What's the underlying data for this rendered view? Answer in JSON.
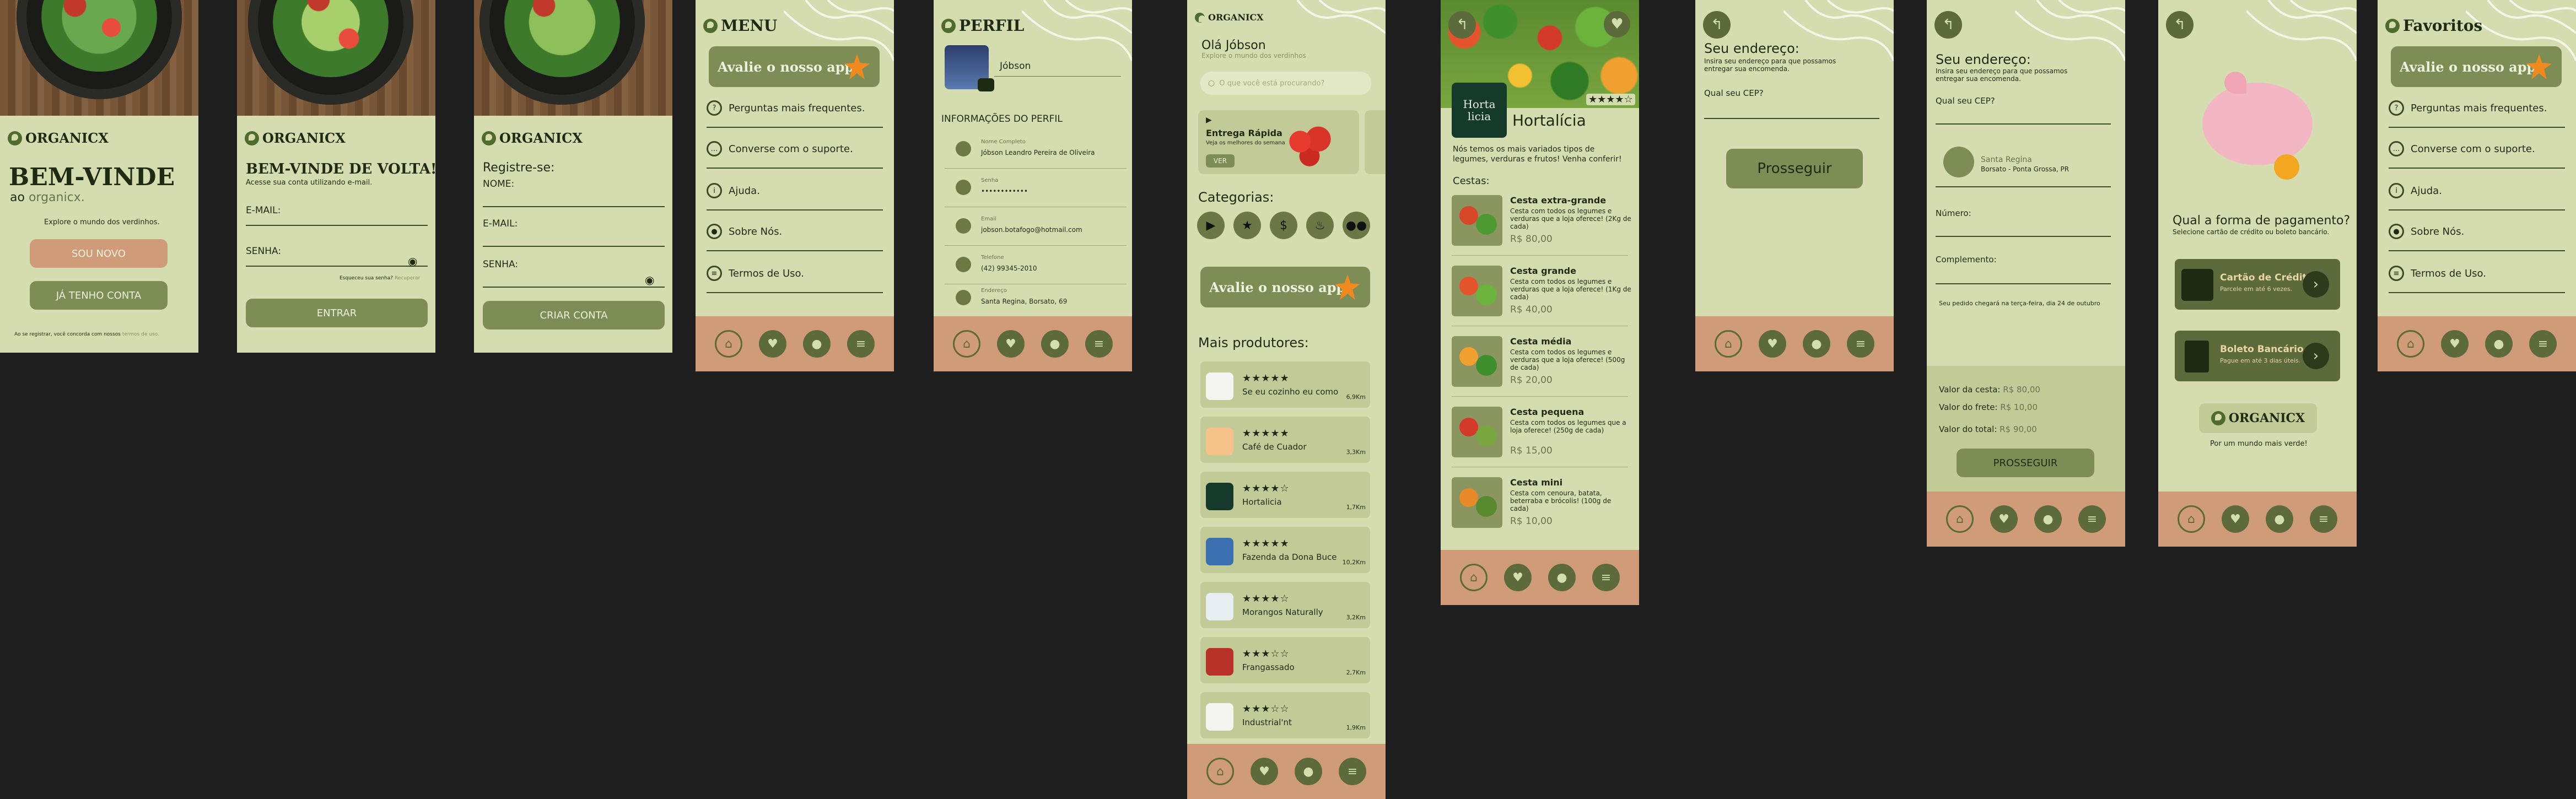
{
  "brand": "ORGANICX",
  "nav": {
    "icons": [
      "home-icon",
      "heart-icon",
      "user-icon",
      "menu-icon"
    ]
  },
  "welcome": {
    "heading": "BEM-VINDE",
    "subtitle_prefix": "ao",
    "subtitle_brand": "organicx.",
    "tagline": "Explore o mundo dos verdinhos.",
    "new_button": "SOU NOVO",
    "have_account_button": "JÁ TENHO CONTA",
    "terms_text": "Ao se registrar, você concorda com nossos",
    "terms_link": "termos de uso."
  },
  "login": {
    "heading": "BEM-VINDE DE VOLTA!",
    "subtitle": "Acesse sua conta utilizando e-mail.",
    "email_label": "E-MAIL:",
    "password_label": "SENHA:",
    "forgot_text": "Esqueceu sua senha?",
    "forgot_link": "Recuperar",
    "enter_button": "ENTRAR"
  },
  "register": {
    "heading": "Registre-se:",
    "name_label": "NOME:",
    "email_label": "E-MAIL:",
    "password_label": "SENHA:",
    "create_button": "CRIAR CONTA"
  },
  "menu": {
    "title": "MENU",
    "rate_banner": "Avalie o nosso app",
    "items": [
      {
        "label": "Perguntas mais frequentes.",
        "icon": "question-icon"
      },
      {
        "label": "Converse com o suporte.",
        "icon": "chat-icon"
      },
      {
        "label": "Ajuda.",
        "icon": "info-icon"
      },
      {
        "label": "Sobre Nós.",
        "icon": "team-icon"
      },
      {
        "label": "Termos de Uso.",
        "icon": "document-icon"
      }
    ]
  },
  "profile": {
    "title": "PERFIL",
    "name": "Jóbson",
    "section_title": "INFORMAÇÕES DO PERFIL",
    "fields": [
      {
        "label": "Nome Completo",
        "value": "Jóbson Leandro Pereira de Oliveira"
      },
      {
        "label": "Senha",
        "value": "••••••••••••"
      },
      {
        "label": "Email",
        "value": "jobson.botafogo@hotmail.com"
      },
      {
        "label": "Telefone",
        "value": "(42) 99345-2010"
      },
      {
        "label": "Endereço",
        "value": "Santa Regina, Borsato, 69"
      }
    ]
  },
  "home": {
    "brand": "ORGANICX",
    "greeting": "Olá Jóbson",
    "greeting_sub": "Explore o mundo dos verdinhos",
    "search_placeholder": "O que você está procurando?",
    "promo_title": "Entrega Rápida",
    "promo_sub": "Veja os melhores do semana",
    "promo_button": "VER",
    "categories_title": "Categorias:",
    "category_icons": [
      "truck-icon",
      "star-icon",
      "dollar-icon",
      "fire-icon",
      "group-icon"
    ],
    "rate_banner": "Avalie o nosso app",
    "producers_title": "Mais produtores:",
    "producers": [
      {
        "name": "Se eu cozinho eu como",
        "stars": "★★★★★",
        "distance": "6,9Km"
      },
      {
        "name": "Café de Cuador",
        "stars": "★★★★★",
        "distance": "3,3Km"
      },
      {
        "name": "Hortalicia",
        "stars": "★★★★☆",
        "distance": "1,7Km"
      },
      {
        "name": "Fazenda da Dona Buce",
        "stars": "★★★★★",
        "distance": "10,2Km"
      },
      {
        "name": "Morangos Naturally",
        "stars": "★★★★☆",
        "distance": "3,2Km"
      },
      {
        "name": "Frangassado",
        "stars": "★★★☆☆",
        "distance": "2,7Km"
      },
      {
        "name": "Industrial'nt",
        "stars": "★★★☆☆",
        "distance": "1,9Km"
      }
    ]
  },
  "store": {
    "logo_line1": "Horta",
    "logo_line2": "licia",
    "name": "Hortalícia",
    "rating": "★★★★☆",
    "description": "Nós temos os mais variados tipos de legumes, verduras e frutos! Venha conferir!",
    "baskets_title": "Cestas:",
    "baskets": [
      {
        "name": "Cesta extra-grande",
        "desc": "Cesta com todos os legumes e verduras que a loja oferece! (2Kg de cada)",
        "price": "R$ 80,00"
      },
      {
        "name": "Cesta grande",
        "desc": "Cesta com todos os legumes e verduras que a loja oferece! (1Kg de cada)",
        "price": "R$ 40,00"
      },
      {
        "name": "Cesta média",
        "desc": "Cesta com todos os legumes e verduras que a loja oferece! (500g de cada)",
        "price": "R$ 20,00"
      },
      {
        "name": "Cesta pequena",
        "desc": "Cesta com todos os legumes que a loja oferece! (250g de cada)",
        "price": "R$ 15,00"
      },
      {
        "name": "Cesta mini",
        "desc": "Cesta com cenoura, batata, beterraba e brócolis! (100g de cada)",
        "price": "R$ 10,00"
      }
    ]
  },
  "address": {
    "title": "Seu endereço:",
    "subtitle": "Insira seu endereço para que possamos entregar sua encomenda.",
    "cep_label": "Qual seu CEP?",
    "continue_button": "Prosseguir"
  },
  "address_filled": {
    "title": "Seu endereço:",
    "subtitle": "Insira seu endereço para que possamos entregar sua encomenda.",
    "cep_label": "Qual seu CEP?",
    "place_name": "Santa Regina",
    "place_detail": "Borsato - Ponta Grossa, PR",
    "number_label": "Número:",
    "complement_label": "Complemento:",
    "delivery_note": "Seu pedido chegará na terça-feira, dia 24 de outubro",
    "basket_value_label": "Valor da cesta:",
    "basket_value": "R$ 80,00",
    "shipping_label": "Valor do frete:",
    "shipping_value": "R$ 10,00",
    "total_label": "Valor do total:",
    "total_value": "R$ 90,00",
    "continue_button": "PROSSEGUIR"
  },
  "payment": {
    "title": "Qual a forma de pagamento?",
    "subtitle": "Selecione cartão de crédito ou boleto bancário.",
    "options": [
      {
        "title": "Cartão de Crédito",
        "sub": "Parcele em até 6 vezes."
      },
      {
        "title": "Boleto Bancário",
        "sub": "Pague em até 3 dias úteis."
      }
    ],
    "brand": "ORGANICX",
    "slogan": "Por um mundo mais verde!"
  },
  "favorites": {
    "title": "Favoritos",
    "rate_banner": "Avalie o nosso app",
    "items": [
      {
        "label": "Perguntas mais frequentes.",
        "icon": "question-icon"
      },
      {
        "label": "Converse com o suporte.",
        "icon": "chat-icon"
      },
      {
        "label": "Ajuda.",
        "icon": "info-icon"
      },
      {
        "label": "Sobre Nós.",
        "icon": "team-icon"
      },
      {
        "label": "Termos de Uso.",
        "icon": "document-icon"
      }
    ]
  },
  "colors": {
    "screen_bg": "#d4dcb0",
    "olive": "#7e8c56",
    "dark_olive": "#5c6a3c",
    "salmon": "#cf9b78",
    "star_orange": "#f08a1e"
  }
}
